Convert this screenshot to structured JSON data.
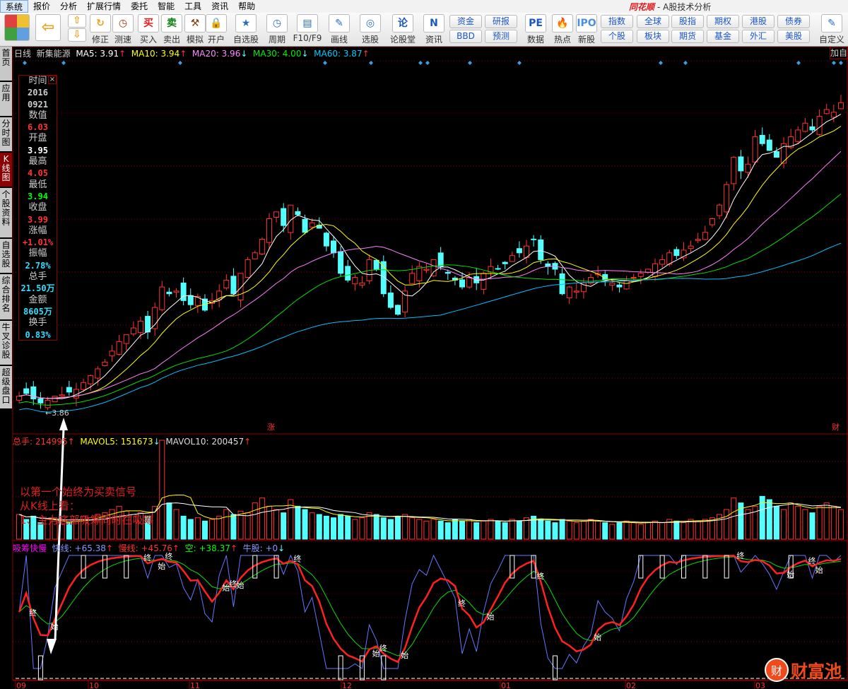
{
  "menu": [
    "系统",
    "报价",
    "分析",
    "扩展行情",
    "委托",
    "智能",
    "工具",
    "资讯",
    "帮助"
  ],
  "app_title": {
    "brand": "同花顺",
    "subtitle": "- A股技术分析"
  },
  "toolbar": {
    "buttons": [
      "修正",
      "测速",
      "买入",
      "卖出",
      "模拟",
      "开户",
      "自选股",
      "周期",
      "F10/F9",
      "画线",
      "选股",
      "论股堂",
      "资讯",
      "数据",
      "热点",
      "新股",
      "自定义"
    ],
    "small_buttons": [
      "资金",
      "BBD",
      "研报",
      "预测",
      "指数",
      "个股",
      "全球",
      "板块",
      "股指",
      "期货",
      "期权",
      "基金",
      "港股",
      "外汇",
      "债券",
      "美股"
    ]
  },
  "left_tabs": [
    "首页",
    "应用",
    "分时图",
    "K线图",
    "个股资料",
    "自选股",
    "综合排名",
    "牛叉诊股",
    "超级盘口"
  ],
  "price_legend": {
    "period": "日线",
    "stock": "新集能源",
    "ma5": "MA5: 3.91",
    "ma10": "MA10: 3.94",
    "ma20": "MA20: 3.96",
    "ma30": "MA30: 4.00",
    "ma60": "MA60: 3.87",
    "up": "↑",
    "down": "↓"
  },
  "add_button": "加自",
  "info_panel": [
    [
      "时间",
      null
    ],
    [
      "2016",
      "#ccc"
    ],
    [
      "0921",
      "#ccc"
    ],
    [
      "数值",
      null
    ],
    [
      "6.03",
      "#ff3333"
    ],
    [
      "开盘",
      null
    ],
    [
      "3.95",
      "#ffffff"
    ],
    [
      "最高",
      null
    ],
    [
      "4.05",
      "#ff3333"
    ],
    [
      "最低",
      null
    ],
    [
      "3.94",
      "#00ff00"
    ],
    [
      "收盘",
      null
    ],
    [
      "3.99",
      "#ff3333"
    ],
    [
      "涨幅",
      null
    ],
    [
      "+1.01%",
      "#ff3333"
    ],
    [
      "振幅",
      null
    ],
    [
      "2.78%",
      "#33ddff"
    ],
    [
      "总手",
      null
    ],
    [
      "21.50万",
      "#33ddff"
    ],
    [
      "金额",
      null
    ],
    [
      "8605万",
      "#33ddff"
    ],
    [
      "换手",
      null
    ],
    [
      "0.83%",
      "#33ddff"
    ]
  ],
  "info_close": "×",
  "low_label": "←3.86",
  "marks": {
    "zhang": "涨",
    "cai": "财"
  },
  "volume_legend": {
    "total": "总手: 214995",
    "mavol5": "MAVOL5: 151673",
    "mavol10": "MAVOL10: 200457"
  },
  "indicator_legend": {
    "name": "吸筹快慢",
    "fast": "快线: +65.38",
    "slow": "慢线: +45.76",
    "empty": "空: +38.37",
    "bull": "牛股: +0"
  },
  "signal_labels": {
    "start": "始",
    "end": "终"
  },
  "note": [
    "以第一个始终为买卖信号",
    "从K线上看：",
    "1、主力底部吸筹同时在吸筹"
  ],
  "x_axis": [
    "09",
    "10",
    "11",
    "12",
    "01",
    "02",
    "03"
  ],
  "watermark": {
    "icon": "财",
    "text": "财富池"
  },
  "colors": {
    "up": "#ff3232",
    "down": "#54ffff",
    "ma5": "#ffffff",
    "ma10": "#ffff00",
    "ma20": "#ff80ff",
    "ma30": "#00e000",
    "ma60": "#00c0ff",
    "grid": "#8b0000"
  },
  "chart_data": {
    "type": "candlestick",
    "closes": [
      3.95,
      3.97,
      3.93,
      3.9,
      3.92,
      3.95,
      3.96,
      3.98,
      4.0,
      4.05,
      4.1,
      4.15,
      4.2,
      4.28,
      4.35,
      4.4,
      4.45,
      4.5,
      4.42,
      4.6,
      4.75,
      4.7,
      4.72,
      4.65,
      4.62,
      4.68,
      4.58,
      4.65,
      4.72,
      4.8,
      4.7,
      4.85,
      4.95,
      5.0,
      5.1,
      5.25,
      5.3,
      5.2,
      5.35,
      5.28,
      5.15,
      5.22,
      5.18,
      5.05,
      5.0,
      4.85,
      4.8,
      4.82,
      4.78,
      4.95,
      4.88,
      4.7,
      4.6,
      4.55,
      4.72,
      4.85,
      4.9,
      4.88,
      4.95,
      4.9,
      4.85,
      4.8,
      4.75,
      4.82,
      4.78,
      4.85,
      4.9,
      4.88,
      4.92,
      4.98,
      5.0,
      5.05,
      5.1,
      4.95,
      4.9,
      4.88,
      4.7,
      4.75,
      4.72,
      4.78,
      4.82,
      4.85,
      4.8,
      4.78,
      4.75,
      4.8,
      4.82,
      4.85,
      4.88,
      4.92,
      4.95,
      5.0,
      4.98,
      5.02,
      5.05,
      5.1,
      5.15,
      5.25,
      5.35,
      5.5,
      5.7,
      5.6,
      5.65,
      5.85,
      5.8,
      5.75,
      5.7,
      5.8,
      5.85,
      5.9,
      5.95,
      5.9,
      6.0,
      6.05,
      6.03,
      6.1
    ],
    "volumes": [
      15,
      12,
      14,
      10,
      12,
      11,
      9,
      10,
      12,
      14,
      13,
      15,
      16,
      18,
      20,
      17,
      15,
      16,
      14,
      20,
      60,
      22,
      18,
      14,
      12,
      13,
      11,
      12,
      14,
      18,
      15,
      17,
      16,
      22,
      25,
      20,
      18,
      16,
      24,
      20,
      18,
      16,
      15,
      14,
      13,
      15,
      14,
      12,
      13,
      16,
      15,
      13,
      12,
      14,
      15,
      13,
      12,
      11,
      12,
      11,
      10,
      12,
      11,
      12,
      10,
      11,
      12,
      11,
      10,
      12,
      11,
      13,
      14,
      12,
      11,
      10,
      12,
      11,
      10,
      11,
      12,
      11,
      10,
      9,
      10,
      11,
      10,
      9,
      10,
      11,
      10,
      12,
      11,
      10,
      12,
      11,
      12,
      13,
      15,
      18,
      25,
      22,
      18,
      20,
      26,
      24,
      20,
      18,
      22,
      20,
      18,
      16,
      20,
      22,
      20,
      18
    ],
    "ylim": [
      3.86,
      6.2
    ],
    "low": 3.86
  }
}
